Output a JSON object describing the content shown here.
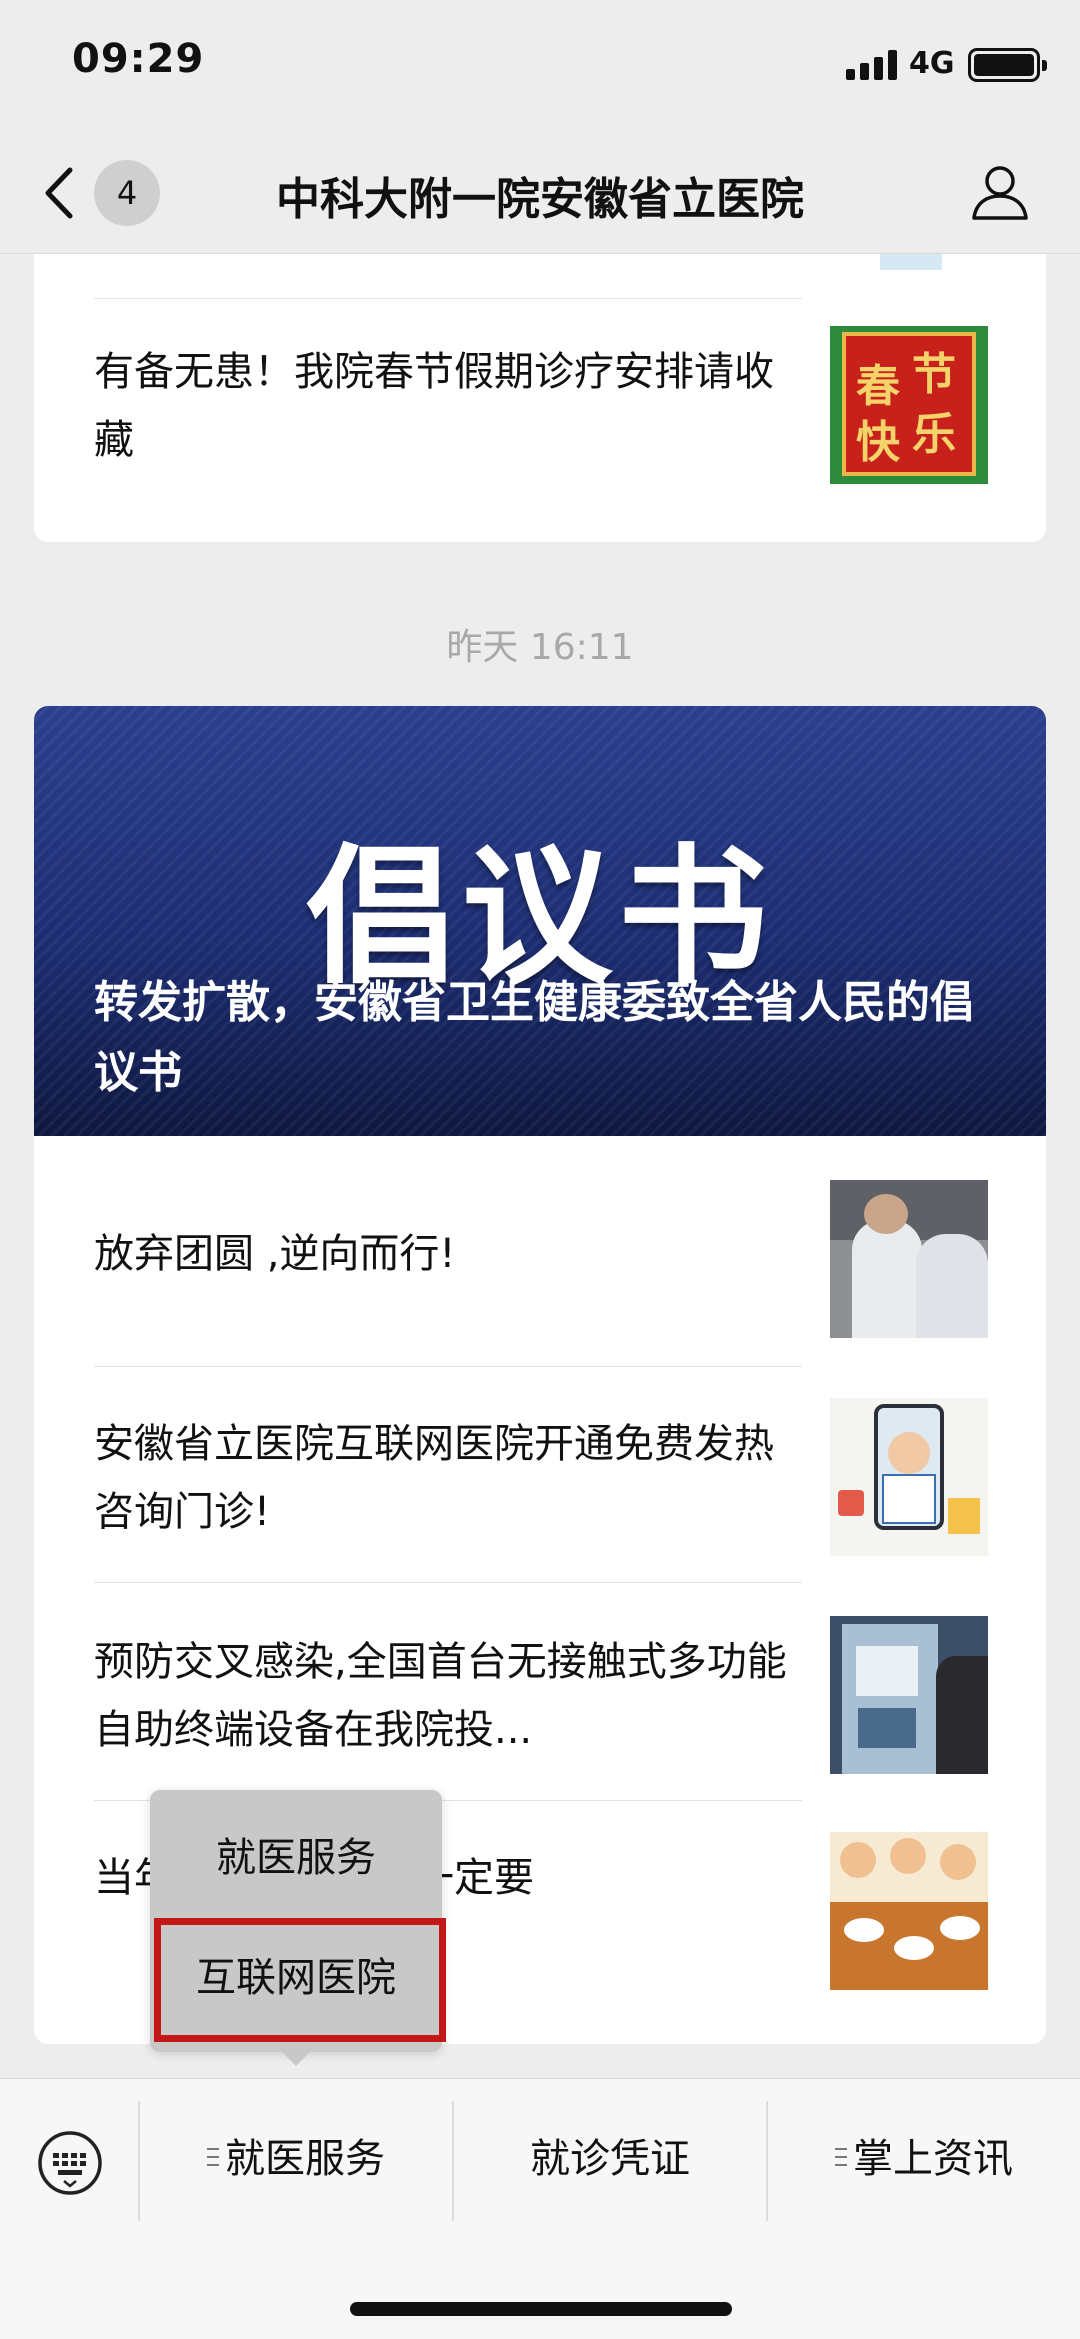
{
  "status_bar": {
    "time": "09:29",
    "network": "4G"
  },
  "nav": {
    "badge_count": "4",
    "title": "中科大附一院安徽省立医院"
  },
  "first_card": {
    "article_title": "有备无患！我院春节假期诊疗安排请收藏",
    "thumb_text": [
      "春",
      "节",
      "快",
      "乐"
    ]
  },
  "timestamp": "昨天 16:11",
  "second_card": {
    "banner_big_text": "倡议书",
    "banner_caption": "转发扩散，安徽省卫生健康委致全省人民的倡议书",
    "articles": [
      {
        "title": "放弃团圆 ,逆向而行!"
      },
      {
        "title": "安徽省立医院互联网医院开通免费发热咨询门诊!"
      },
      {
        "title": "预防交叉感染,全国首台无接触式多功能自助终端设备在我院投..."
      },
      {
        "title": "当年情，这七点您一定要"
      }
    ]
  },
  "popup_menu": {
    "items": [
      "就医服务",
      "互联网医院"
    ],
    "highlight_color": "#c21818"
  },
  "bottom_menu": {
    "items": [
      "就医服务",
      "就诊凭证",
      "掌上资讯"
    ]
  },
  "colors": {
    "banner_blue": "#1c2d72",
    "background": "#ededed"
  }
}
